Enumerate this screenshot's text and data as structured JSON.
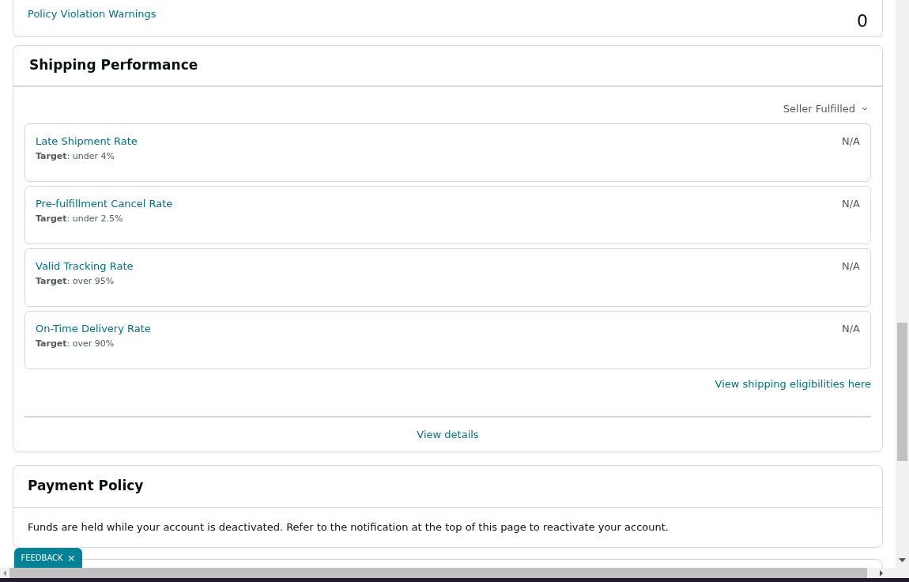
{
  "policy_card": {
    "label": "Policy Violation Warnings",
    "count": "0"
  },
  "shipping": {
    "title": "Shipping Performance",
    "filter": "Seller Fulfilled",
    "metrics": [
      {
        "name": "Late Shipment Rate",
        "target": "**Target**: under 4%",
        "value": "N/A"
      },
      {
        "name": "Pre-fulfillment Cancel Rate",
        "target": "**Target**: under 2.5%",
        "value": "N/A"
      },
      {
        "name": "Valid Tracking Rate",
        "target": "**Target**: over 95%",
        "value": "N/A"
      },
      {
        "name": "On-Time Delivery Rate",
        "target": "**Target**: over 90%",
        "value": "N/A"
      }
    ],
    "eligibility_link": "View shipping eligibilities here",
    "details_link": "View details"
  },
  "payment": {
    "title": "Payment Policy",
    "text": "Funds are held while your account is deactivated. Refer to the notification at the top of this page to reactivate your account."
  },
  "feedback": {
    "label": "FEEDBACK",
    "close": "×"
  }
}
